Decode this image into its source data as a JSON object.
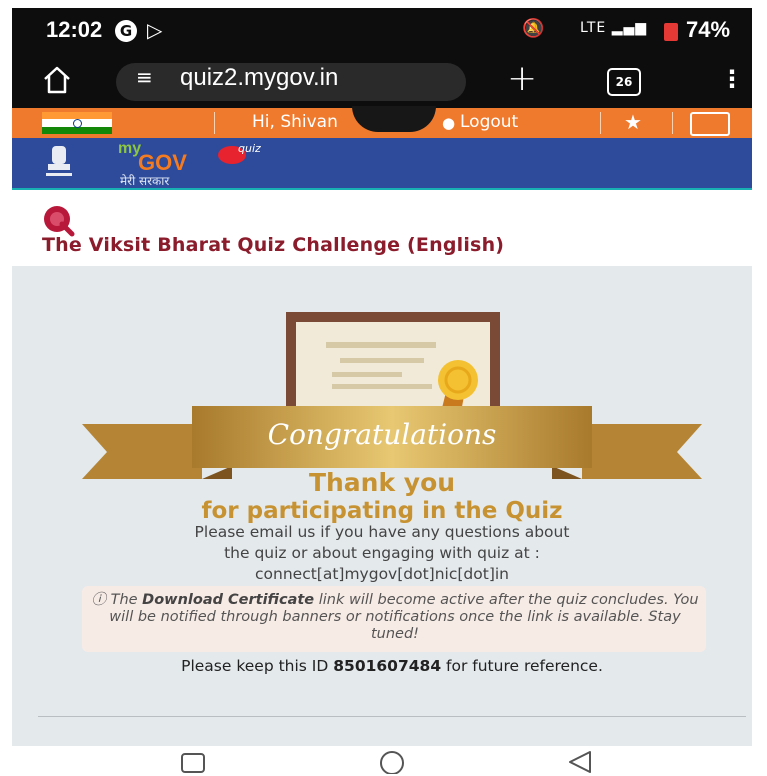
{
  "status_bar": {
    "time": "12:02",
    "g_badge": "G",
    "battery": "74%",
    "signal_text": "LTE",
    "colors": {
      "battery_icon": "#e53935"
    }
  },
  "browser": {
    "url": "quiz2.mygov.in",
    "tab_count": "26",
    "icons": [
      "home-icon",
      "site-settings-icon",
      "new-tab-icon",
      "tab-switcher-icon",
      "overflow-menu-icon"
    ]
  },
  "top_nav": {
    "greeting": "Hi, Shivan",
    "logout_label": "Logout",
    "colors": {
      "background": "#ef7a2d"
    }
  },
  "brand": {
    "logo_my": "my",
    "logo_gov": "GOV",
    "logo_quiz": "quiz",
    "tagline": "मेरी सरकार"
  },
  "page": {
    "title": "The Viksit Bharat Quiz Challenge (English)",
    "title_color": "#8b1c2c"
  },
  "result": {
    "congratulations": "Congratulations",
    "thank_you": "Thank you",
    "participating": "for participating in the Quiz",
    "email_line1": "Please email us if you have any questions about",
    "email_line2": "the quiz or about engaging with quiz at :",
    "email_address": "connect[at]mygov[dot]nic[dot]in",
    "notice_prefix": "The ",
    "notice_bold": "Download Certificate",
    "notice_suffix": " link will become active after the quiz concludes. You will be notified through banners or notifications once the link is available. Stay tuned!",
    "keep_prefix": "Please keep this ID ",
    "participant_id": "8501607484",
    "keep_suffix": " for future reference.",
    "accent_color": "#c79332"
  },
  "system_nav": {
    "icons": [
      "recents-icon",
      "home-circle-icon",
      "back-icon"
    ]
  }
}
